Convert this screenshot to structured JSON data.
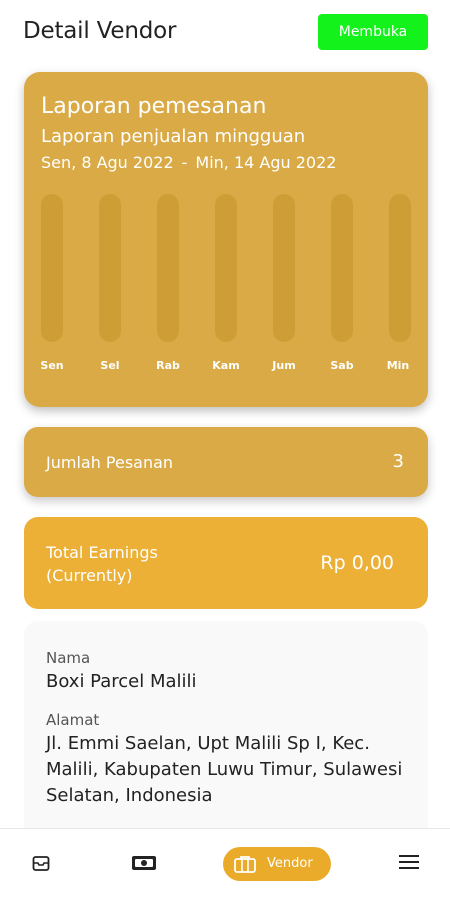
{
  "header": {
    "title": "Detail Vendor",
    "open_button": "Membuka"
  },
  "report": {
    "title": "Laporan pemesanan",
    "subtitle": "Laporan penjualan mingguan",
    "date_start": "Sen, 8 Agu 2022",
    "date_sep": "-",
    "date_end": "Min, 14 Agu 2022",
    "days": [
      "Sen",
      "Sel",
      "Rab",
      "Kam",
      "Jum",
      "Sab",
      "Min"
    ]
  },
  "orders": {
    "label": "Jumlah Pesanan",
    "value": "3"
  },
  "earnings": {
    "label_line1": "Total Earnings",
    "label_line2": "(Currently)",
    "value": "Rp 0,00"
  },
  "vendor": {
    "name_label": "Nama",
    "name": "Boxi Parcel Malili",
    "address_label": "Alamat",
    "address": "Jl. Emmi Saelan, Upt Malili Sp I, Kec. Malili, Kabupaten Luwu Timur, Sulawesi Selatan, Indonesia"
  },
  "nav": {
    "items": [
      {
        "icon": "inbox-icon"
      },
      {
        "icon": "money-icon"
      },
      {
        "icon": "briefcase-icon",
        "label": "Vendor",
        "active": true
      },
      {
        "icon": "menu-icon"
      }
    ]
  },
  "colors": {
    "accent": "#ebb035",
    "card": "#d9aa45",
    "open_button": "#13f21b"
  }
}
